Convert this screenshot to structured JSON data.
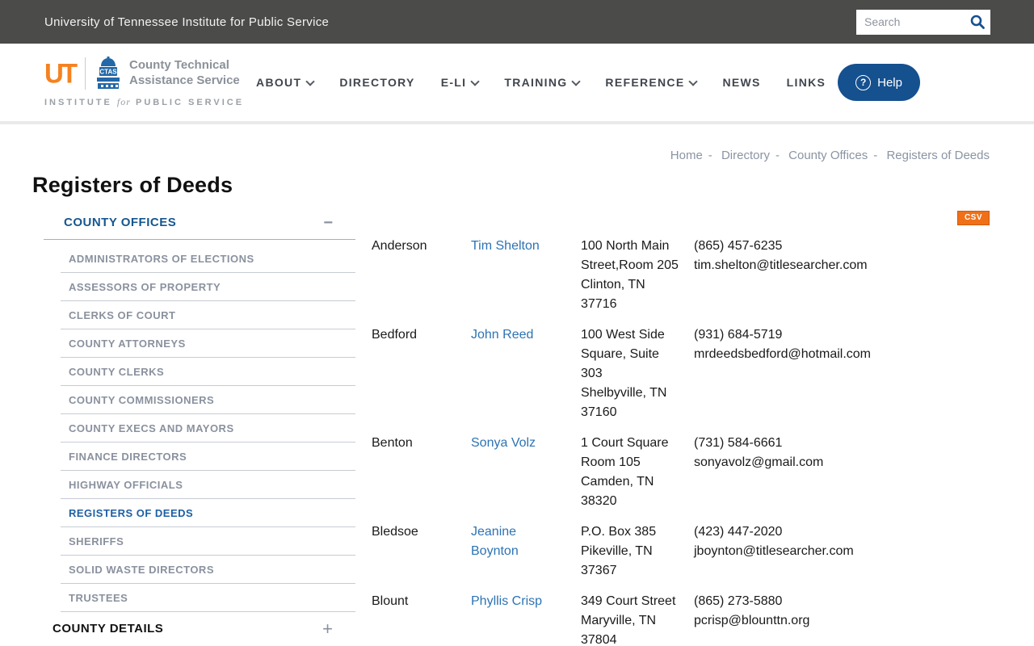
{
  "topbar": {
    "title": "University of Tennessee Institute for Public Service",
    "search_placeholder": "Search"
  },
  "header": {
    "logo": {
      "ut": "UT",
      "ctas": "CTAS",
      "name1": "County Technical",
      "name2": "Assistance Service",
      "inst1": "INSTITUTE",
      "inst2": "for",
      "inst3": "PUBLIC SERVICE"
    },
    "nav": [
      {
        "label": "ABOUT",
        "caret": "true"
      },
      {
        "label": "DIRECTORY",
        "caret": "false"
      },
      {
        "label": "E-LI",
        "caret": "true"
      },
      {
        "label": "TRAINING",
        "caret": "true"
      },
      {
        "label": "REFERENCE",
        "caret": "true"
      },
      {
        "label": "NEWS",
        "caret": "false"
      },
      {
        "label": "LINKS",
        "caret": "false"
      }
    ],
    "help_icon": "?",
    "help_label": "Help"
  },
  "breadcrumb": {
    "separator": "-",
    "items": [
      "Home",
      "Directory",
      "County Offices",
      "Registers of Deeds"
    ]
  },
  "page": {
    "title": "Registers of Deeds"
  },
  "sidebar": {
    "offices_header": "COUNTY OFFICES",
    "collapse_icon": "−",
    "office_items": [
      {
        "label": "ADMINISTRATORS OF ELECTIONS",
        "state": ""
      },
      {
        "label": "ASSESSORS OF PROPERTY",
        "state": ""
      },
      {
        "label": "CLERKS OF COURT",
        "state": ""
      },
      {
        "label": "COUNTY ATTORNEYS",
        "state": ""
      },
      {
        "label": "COUNTY CLERKS",
        "state": ""
      },
      {
        "label": "COUNTY COMMISSIONERS",
        "state": ""
      },
      {
        "label": "COUNTY EXECS AND MAYORS",
        "state": ""
      },
      {
        "label": "FINANCE DIRECTORS",
        "state": ""
      },
      {
        "label": "HIGHWAY OFFICIALS",
        "state": ""
      },
      {
        "label": "REGISTERS OF DEEDS",
        "state": "active"
      },
      {
        "label": "SHERIFFS",
        "state": ""
      },
      {
        "label": "SOLID WASTE DIRECTORS",
        "state": ""
      },
      {
        "label": "TRUSTEES",
        "state": ""
      }
    ],
    "details_header": "COUNTY DETAILS",
    "expand_icon": "+"
  },
  "table": {
    "csv_label": "CSV",
    "rows": [
      {
        "county": "Anderson",
        "official": "Tim Shelton",
        "address": "100 North Main Street,Room 205\nClinton, TN 37716",
        "phone": "(865) 457-6235",
        "email": "tim.shelton@titlesearcher.com"
      },
      {
        "county": "Bedford",
        "official": "John Reed",
        "address": "100 West Side Square, Suite 303\nShelbyville, TN 37160",
        "phone": "(931) 684-5719",
        "email": "mrdeedsbedford@hotmail.com"
      },
      {
        "county": "Benton",
        "official": "Sonya Volz",
        "address": "1 Court Square Room 105\nCamden, TN 38320",
        "phone": "(731) 584-6661",
        "email": "sonyavolz@gmail.com"
      },
      {
        "county": "Bledsoe",
        "official": "Jeanine Boynton",
        "address": "P.O. Box 385\nPikeville, TN 37367",
        "phone": "(423) 447-2020",
        "email": "jboynton@titlesearcher.com"
      },
      {
        "county": "Blount",
        "official": "Phyllis Crisp",
        "address": "349 Court Street\nMaryville, TN 37804",
        "phone": "(865) 273-5880",
        "email": "pcrisp@blounttn.org"
      }
    ]
  }
}
